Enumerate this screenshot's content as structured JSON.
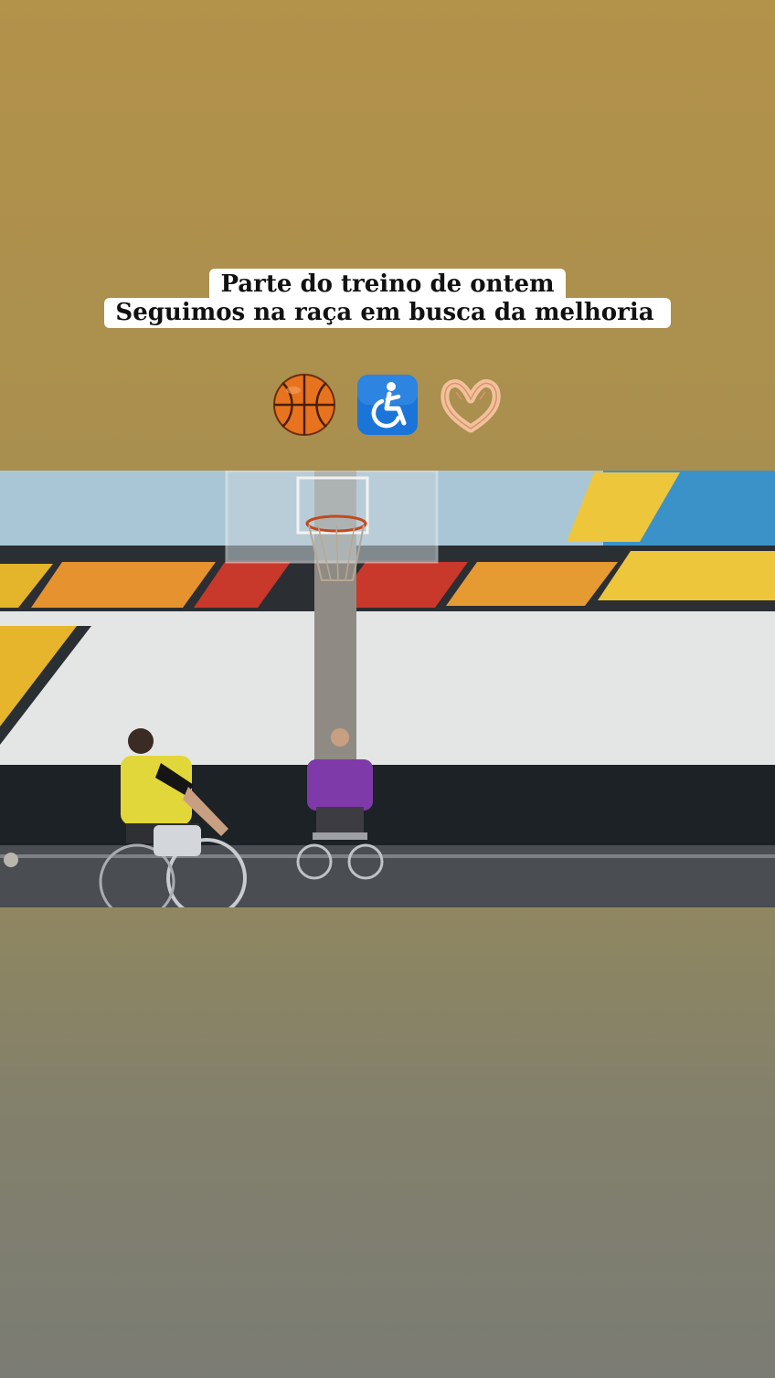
{
  "story": {
    "caption_line_1": "Parte do treino de ontem",
    "caption_line_2": "Seguimos na raça em busca da melhoria",
    "emojis": [
      "basketball-icon",
      "wheelchair-symbol-icon",
      "heart-hands-icon"
    ]
  },
  "colors": {
    "background_top": "#b3924a",
    "background_bottom": "#7b7c74",
    "caption_bg": "#ffffff",
    "caption_text": "#111111"
  },
  "video": {
    "scene": "indoor court, two wheelchair basketball players",
    "player_1_jersey": "yellow",
    "player_2_jersey": "purple"
  }
}
